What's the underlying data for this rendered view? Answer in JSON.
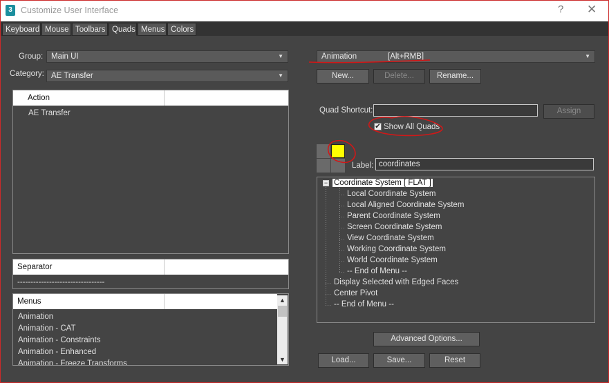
{
  "window": {
    "title": "Customize User Interface",
    "app_icon": "3",
    "help_label": "?",
    "close_label": "✕"
  },
  "tabs": [
    "Keyboard",
    "Mouse",
    "Toolbars",
    "Quads",
    "Menus",
    "Colors"
  ],
  "active_tab": "Quads",
  "left": {
    "group_label": "Group:",
    "group_value": "Main UI",
    "category_label": "Category:",
    "category_value": "AE Transfer",
    "actions_header": "Action",
    "actions": [
      "AE Transfer"
    ],
    "separator_header": "Separator",
    "separator_item": "---------------------------------",
    "menus_header": "Menus",
    "menus": [
      "Animation",
      "Animation - CAT",
      "Animation - Constraints",
      "Animation - Enhanced",
      "Animation - Freeze Transforms"
    ]
  },
  "right": {
    "quad_dropdown_name": "Animation",
    "quad_dropdown_shortcut": "[Alt+RMB]",
    "new_button": "New...",
    "delete_button": "Delete...",
    "rename_button": "Rename...",
    "quad_shortcut_label": "Quad Shortcut:",
    "quad_shortcut_value": "",
    "assign_button": "Assign",
    "show_all_quads_label": "Show All Quads",
    "show_all_quads_checked": true,
    "label_label": "Label:",
    "label_value": "coordinates",
    "tree": {
      "root": "Coordinate System [ FLAT ]",
      "children": [
        "Local Coordinate System",
        "Local Aligned Coordinate System",
        "Parent Coordinate System",
        "Screen Coordinate System",
        "View Coordinate System",
        "Working Coordinate System",
        "World Coordinate System",
        "-- End of Menu --"
      ],
      "top_level": [
        "Display Selected with Edged Faces",
        "Center Pivot",
        "-- End of Menu --"
      ]
    },
    "advanced_options_button": "Advanced Options...",
    "load_button": "Load...",
    "save_button": "Save...",
    "reset_button": "Reset"
  },
  "colors": {
    "quad_selected": "#ffff00",
    "annotation": "#d01818"
  }
}
